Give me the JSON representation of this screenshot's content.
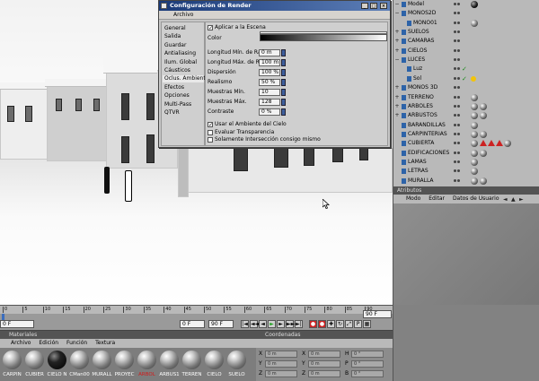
{
  "dialog": {
    "title": "Configuración de Render",
    "menu": "Archivo",
    "nav": [
      "General",
      "Salida",
      "Guardar",
      "Antialiasing",
      "Ilum. Global",
      "Cáusticos",
      "Oclus. Ambiental",
      "Efectos",
      "Opciones",
      "Multi-Pass",
      "QTVR"
    ],
    "selected_nav": "Oclus. Ambiental",
    "apply_label": "Aplicar a la Escena",
    "apply_checked": true,
    "color_label": "Color",
    "fields": [
      {
        "label": "Longitud Mín. de Rayos",
        "value": "0 m"
      },
      {
        "label": "Longitud Máx. de Rayos",
        "value": "100 m"
      },
      {
        "label": "Dispersión",
        "value": "100 %"
      },
      {
        "label": "Realismo",
        "value": "50 %"
      },
      {
        "label": "Muestras Mín.",
        "value": "10"
      },
      {
        "label": "Muestras Máx.",
        "value": "128"
      },
      {
        "label": "Contraste",
        "value": "0 %"
      }
    ],
    "checkboxes": [
      {
        "label": "Usar el Ambiente del Cielo",
        "checked": true
      },
      {
        "label": "Evaluar Transparencia",
        "checked": false
      },
      {
        "label": "Solamente Intersección consigo mismo",
        "checked": false
      }
    ]
  },
  "objects": [
    {
      "name": "Model",
      "indent": 0,
      "twisty": "−",
      "tags": [
        "ball-dark"
      ]
    },
    {
      "name": "MONOS2D",
      "indent": 0,
      "twisty": "−",
      "tags": []
    },
    {
      "name": "MONO01",
      "indent": 1,
      "twisty": "",
      "tags": [
        "ball"
      ]
    },
    {
      "name": "SUELOS",
      "indent": 0,
      "twisty": "+",
      "tags": []
    },
    {
      "name": "CAMARAS",
      "indent": 0,
      "twisty": "+",
      "tags": []
    },
    {
      "name": "CIELOS",
      "indent": 0,
      "twisty": "+",
      "tags": []
    },
    {
      "name": "LUCES",
      "indent": 0,
      "twisty": "−",
      "tags": []
    },
    {
      "name": "Luz",
      "indent": 1,
      "twisty": "",
      "tags": [
        "check"
      ]
    },
    {
      "name": "Sol",
      "indent": 1,
      "twisty": "",
      "tags": [
        "check",
        "sun"
      ]
    },
    {
      "name": "MONOS 3D",
      "indent": 0,
      "twisty": "+",
      "tags": []
    },
    {
      "name": "TERRENO",
      "indent": 0,
      "twisty": "+",
      "tags": [
        "ball"
      ]
    },
    {
      "name": "ARBOLES",
      "indent": 0,
      "twisty": "+",
      "tags": [
        "ball",
        "ball"
      ]
    },
    {
      "name": "ARBUSTOS",
      "indent": 0,
      "twisty": "+",
      "tags": [
        "ball",
        "ball"
      ]
    },
    {
      "name": "BARANDILLAS",
      "indent": 0,
      "twisty": "",
      "tags": [
        "ball"
      ]
    },
    {
      "name": "CARPINTERIAS",
      "indent": 0,
      "twisty": "",
      "tags": [
        "ball",
        "ball"
      ]
    },
    {
      "name": "CUBIERTA",
      "indent": 0,
      "twisty": "",
      "tags": [
        "ball",
        "tri",
        "tri",
        "tri",
        "ball"
      ]
    },
    {
      "name": "EDIFICACIONES",
      "indent": 0,
      "twisty": "",
      "tags": [
        "ball",
        "ball"
      ]
    },
    {
      "name": "LAMAS",
      "indent": 0,
      "twisty": "",
      "tags": [
        "ball"
      ]
    },
    {
      "name": "LETRAS",
      "indent": 0,
      "twisty": "",
      "tags": [
        "ball"
      ]
    },
    {
      "name": "MURALLA",
      "indent": 0,
      "twisty": "",
      "tags": [
        "ball",
        "ball"
      ]
    }
  ],
  "attributes": {
    "title": "Atributos",
    "menu": [
      "Modo",
      "Editar",
      "Datos de Usuario"
    ]
  },
  "timeline": {
    "ticks": [
      "0",
      "5",
      "10",
      "15",
      "20",
      "25",
      "30",
      "35",
      "40",
      "45",
      "50",
      "55",
      "60",
      "65",
      "70",
      "75",
      "80",
      "85",
      "90"
    ],
    "current": "0 F",
    "start": "0 F",
    "end": "90 F",
    "end_right": "90 F"
  },
  "materials": {
    "title": "Materiales",
    "menu": [
      "Archivo",
      "Edición",
      "Función",
      "Textura"
    ],
    "items": [
      {
        "label": "CARPIN",
        "black": false
      },
      {
        "label": "CUBIER",
        "black": false
      },
      {
        "label": "CIELO N",
        "black": true
      },
      {
        "label": "CMan00",
        "black": false
      },
      {
        "label": "MURALL",
        "black": false
      },
      {
        "label": "PROYEC",
        "black": false
      },
      {
        "label": "ARBOL",
        "black": false,
        "selected": true
      },
      {
        "label": "ARBUS1",
        "black": false
      },
      {
        "label": "TERREN",
        "black": false
      },
      {
        "label": "CIELO",
        "black": false
      },
      {
        "label": "SUELO",
        "black": false
      }
    ]
  },
  "coordinates": {
    "title": "Coordenadas",
    "rows": [
      {
        "axis": "X",
        "v1": "0 m",
        "axis2": "X",
        "v2": "0 m",
        "axis3": "H",
        "v3": "0 °"
      },
      {
        "axis": "Y",
        "v1": "0 m",
        "axis2": "Y",
        "v2": "0 m",
        "axis3": "P",
        "v3": "0 °"
      },
      {
        "axis": "Z",
        "v1": "0 m",
        "axis2": "Z",
        "v2": "0 m",
        "axis3": "B",
        "v3": "0 °"
      }
    ]
  }
}
